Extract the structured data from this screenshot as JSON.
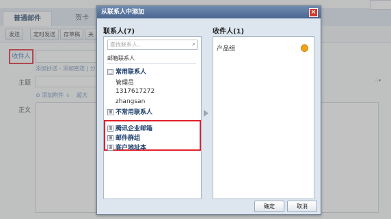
{
  "compose": {
    "tab_active": "普通邮件",
    "tab_other": "贺卡",
    "toolbar": [
      "发送",
      "定时发送",
      "存草稿",
      "关"
    ],
    "recipient_label": "收件人",
    "recipient_links": "添加抄送 - 添加密送 | 分",
    "subject_label": "主题",
    "attachment_links": "添加附件 ↓",
    "attachment_extra": "超大",
    "body_label": "正文"
  },
  "dialog": {
    "title": "从联系人中添加",
    "close_icon": "×",
    "contacts_heading": "联系人(7)",
    "search_placeholder": "查找联系人...",
    "section_label": "邮箱联系人",
    "groups": {
      "common": "常用联系人",
      "common_expand": "□",
      "uncommon": "不常用联系人",
      "uncommon_expand": "⊞",
      "tencent": "腾讯企业邮箱",
      "tencent_expand": "⊞",
      "mail_group": "邮件群组",
      "mail_group_expand": "⊞",
      "address_book": "客户地址本",
      "address_book_expand": "⊞"
    },
    "contacts": [
      "管理员",
      "1317617272",
      "zhangsan"
    ],
    "recipients_heading": "收件人(1)",
    "recipients": [
      "产品组"
    ],
    "ok_label": "确定",
    "cancel_label": "取消"
  },
  "colors": {
    "accent": "#4a6690",
    "highlight": "#e0202a",
    "status": "#f2a11a"
  }
}
